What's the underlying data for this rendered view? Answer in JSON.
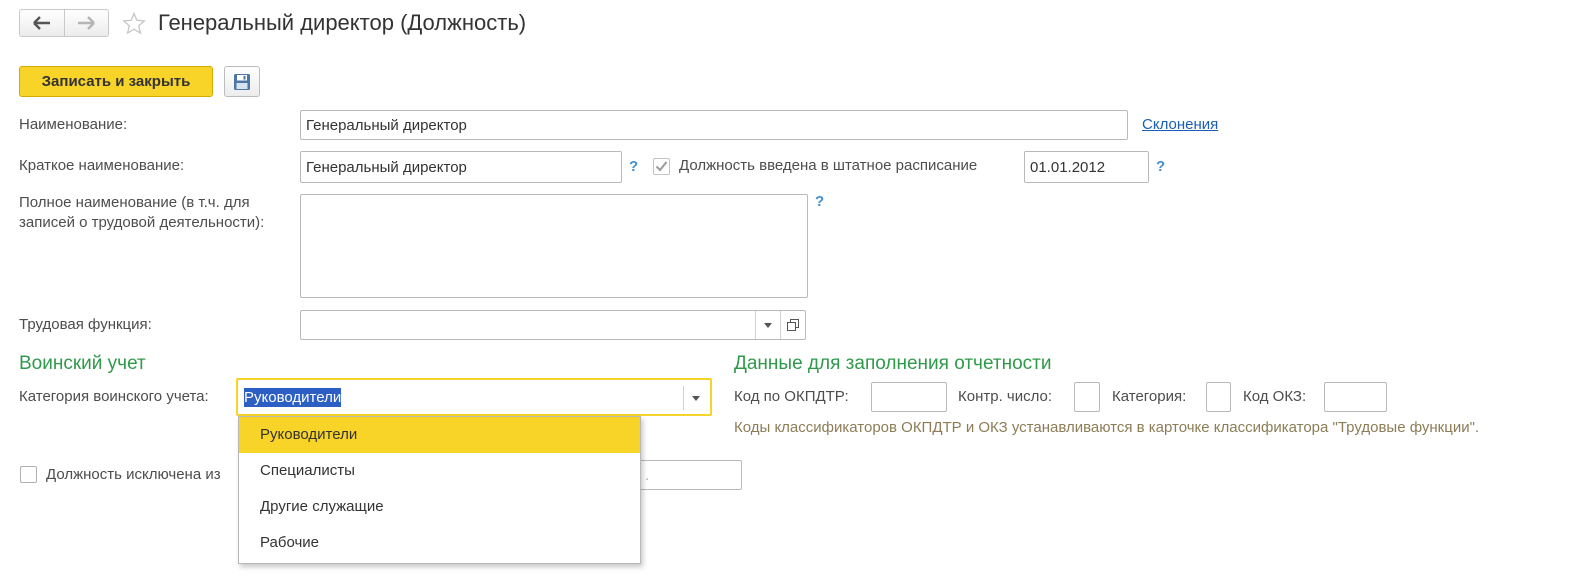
{
  "window": {
    "title": "Генеральный директор (Должность)"
  },
  "toolbar": {
    "save_close_label": "Записать и закрыть"
  },
  "form": {
    "name": {
      "label": "Наименование:",
      "value": "Генеральный директор",
      "link": "Склонения"
    },
    "short_name": {
      "label": "Краткое наименование:",
      "value": "Генеральный директор",
      "help": "?"
    },
    "staff": {
      "label": "Должность введена в штатное расписание",
      "checked": true,
      "date": "01.01.2012",
      "help": "?"
    },
    "full_name": {
      "label_line1": "Полное наименование (в т.ч. для",
      "label_line2": "записей о трудовой деятельности):",
      "value": "",
      "help": "?"
    },
    "labor_function": {
      "label": "Трудовая функция:",
      "value": ""
    }
  },
  "military": {
    "title": "Воинский учет",
    "category_label": "Категория воинского учета:",
    "category_value": "Руководители",
    "options": [
      "Руководители",
      "Специалисты",
      "Другие служащие",
      "Рабочие"
    ],
    "selected_index": 0
  },
  "excluded": {
    "label": "Должность исключена из",
    "checked": false,
    "tail_placeholder": "."
  },
  "reporting": {
    "title": "Данные для заполнения отчетности",
    "okpdtr_label": "Код по ОКПДТР:",
    "control_label": "Контр. число:",
    "category_label": "Категория:",
    "okz_label": "Код ОКЗ:",
    "hint": "Коды классификаторов ОКПДТР и ОКЗ устанавливаются в карточке классификатора \"Трудовые функции\"."
  },
  "colors": {
    "accent_yellow": "#f8d328",
    "section_green": "#2f9a4a",
    "link_blue": "#1a5fb4",
    "help_blue": "#3f8fd2"
  },
  "icons": [
    "arrow-left-icon",
    "arrow-right-icon",
    "star-icon",
    "floppy-disk-icon",
    "check-icon",
    "chevron-down-icon",
    "open-form-icon"
  ]
}
